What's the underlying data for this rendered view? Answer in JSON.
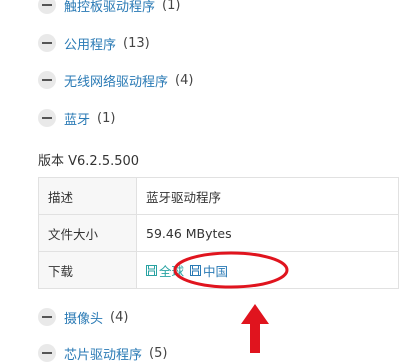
{
  "categories_top": [
    {
      "label": "触控板驱动程序",
      "count": "(1)"
    },
    {
      "label": "公用程序",
      "count": "(13)"
    },
    {
      "label": "无线网络驱动程序",
      "count": "(4)"
    },
    {
      "label": "蓝牙",
      "count": "(1)"
    }
  ],
  "driver": {
    "version": "版本 V6.2.5.500",
    "description_key": "描述",
    "description_value": "蓝牙驱动程序",
    "size_key": "文件大小",
    "size_value": "59.46 MBytes",
    "download_key": "下载",
    "download_global": "全球",
    "download_china": "中国"
  },
  "categories_bottom": [
    {
      "label": "摄像头",
      "count": "(4)"
    },
    {
      "label": "芯片驱动程序",
      "count": "(5)"
    }
  ],
  "colors": {
    "annotation": "#e0141e",
    "link": "#2a7ab5",
    "link_teal": "#2aa3a3"
  },
  "icons": {
    "collapse": "minus-circle-icon",
    "download": "floppy-disk-icon"
  }
}
